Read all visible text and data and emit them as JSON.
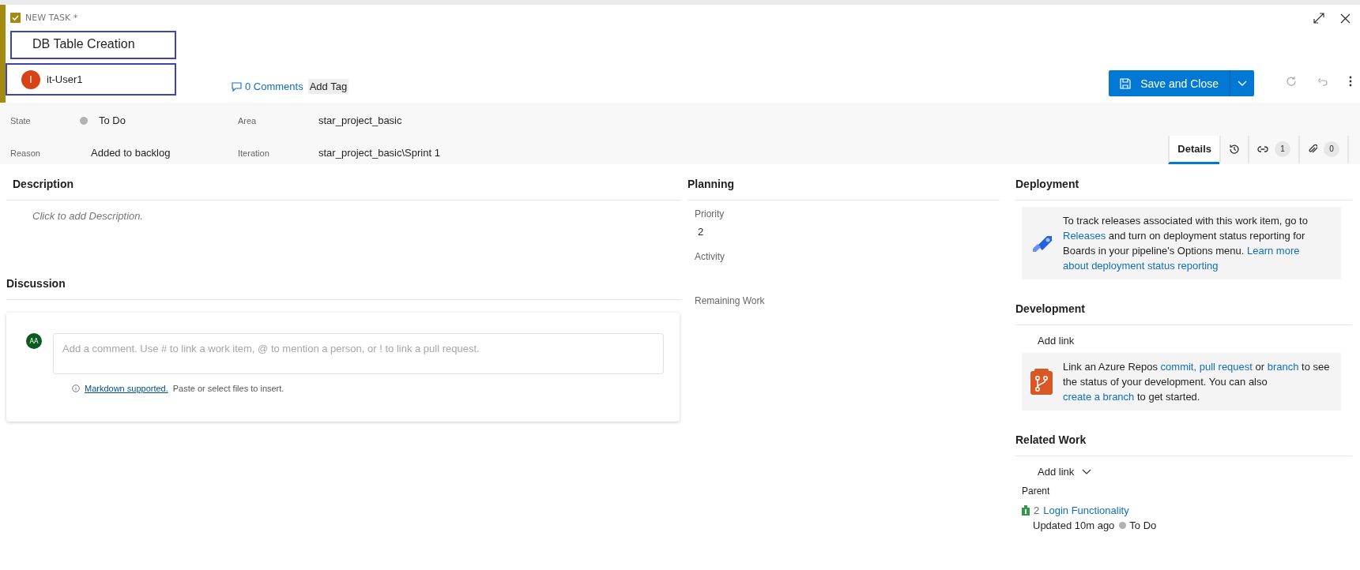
{
  "header": {
    "type_label": "NEW TASK *",
    "title": "DB Table Creation",
    "assignee": {
      "name": "it-User1",
      "initial": "I"
    },
    "comments": "0 Comments",
    "add_tag": "Add Tag",
    "save_button": "Save and Close"
  },
  "fields": [
    {
      "label": "State",
      "value": "To Do",
      "color": "#b2b2b2"
    },
    {
      "label": "Reason",
      "value": "Added to backlog"
    },
    {
      "label": "Area",
      "value": "star_project_basic"
    },
    {
      "label": "Iteration",
      "value": "star_project_basic\\Sprint 1"
    }
  ],
  "tabs": [
    {
      "kind": "text",
      "label": "Details",
      "selected": true
    },
    {
      "kind": "history",
      "selected": false
    },
    {
      "kind": "links",
      "count": "1",
      "selected": false
    },
    {
      "kind": "attachments",
      "count": "0",
      "selected": false
    }
  ],
  "description": {
    "heading": "Description",
    "placeholder": "Click to add Description."
  },
  "discussion": {
    "heading": "Discussion",
    "avatar": "AA",
    "placeholder": "Add a comment. Use # to link a work item, @ to mention a person, or ! to link a pull request.",
    "hint_link": "Markdown supported.",
    "hint_text": "Paste or select files to insert."
  },
  "planning": {
    "heading": "Planning",
    "fields": [
      {
        "label": "Priority",
        "value": "2"
      },
      {
        "label": "Activity"
      },
      {
        "label": "Remaining Work"
      }
    ]
  },
  "deployment": {
    "heading": "Deployment",
    "segments": [
      {
        "kind": "text",
        "text": "To track releases associated with this work item, go to "
      },
      {
        "kind": "link",
        "text": "Releases"
      },
      {
        "kind": "text",
        "text": " and turn on deployment status reporting for Boards in your pipeline's Options menu. "
      },
      {
        "kind": "link",
        "text": "Learn more"
      },
      {
        "kind": "link",
        "text": "about deployment status reporting"
      }
    ]
  },
  "development": {
    "heading": "Development",
    "add_link": "Add link",
    "segments": [
      {
        "kind": "text",
        "text": "Link an Azure Repos "
      },
      {
        "kind": "link",
        "text": "commit,"
      },
      {
        "kind": "link",
        "text": "pull request"
      },
      {
        "kind": "text",
        "text": " or "
      },
      {
        "kind": "link",
        "text": "branch"
      },
      {
        "kind": "text",
        "text": " to see the status of your development. You can also "
      },
      {
        "kind": "link",
        "text": "create a branch"
      },
      {
        "kind": "text",
        "text": " to get started."
      }
    ]
  },
  "related_work": {
    "heading": "Related Work",
    "add_link": "Add link",
    "group": "Parent",
    "items": [
      {
        "id": "2",
        "title": "Login Functionality",
        "updated": "Updated 10m ago",
        "state": "To Do",
        "color": "#b2b2b2"
      }
    ]
  }
}
